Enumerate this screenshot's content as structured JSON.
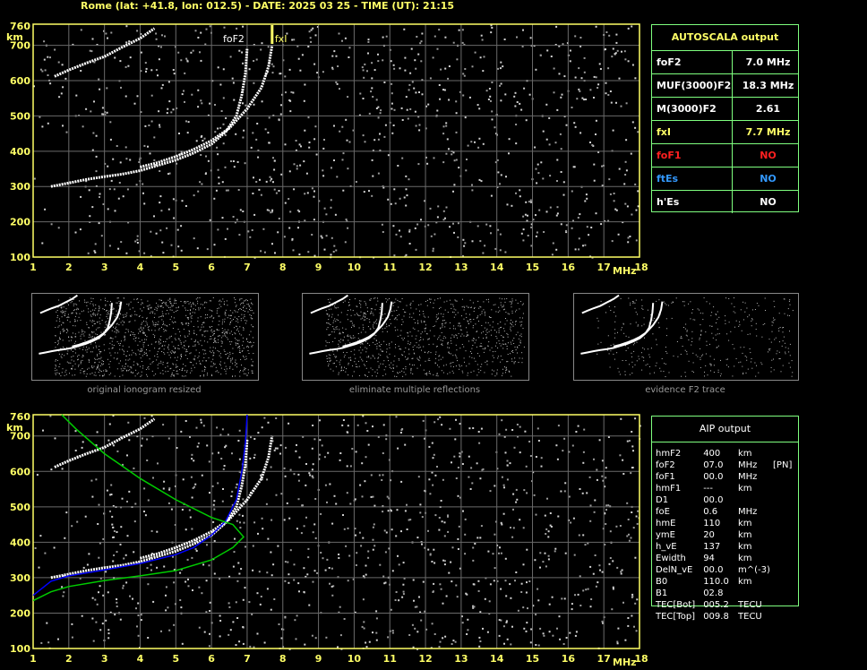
{
  "header": "Rome (lat: +41.8, lon: 012.5) - DATE: 2025 03 25 - TIME (UT): 21:15",
  "chart_data": [
    {
      "type": "scatter",
      "title": "",
      "xlabel": "MHz",
      "ylabel": "km",
      "xlim": [
        1,
        18
      ],
      "ylim": [
        100,
        760
      ],
      "xticks": [
        1,
        2,
        3,
        4,
        5,
        6,
        7,
        8,
        9,
        10,
        11,
        12,
        13,
        14,
        15,
        16,
        17,
        18
      ],
      "yticks": [
        100,
        200,
        300,
        400,
        500,
        600,
        700
      ],
      "ytop_label": "760",
      "grid": true,
      "annotations": [
        {
          "text": "foF2",
          "x": 7.0
        },
        {
          "text": "fxI",
          "x": 7.7
        }
      ],
      "series": [
        {
          "name": "",
          "color": "#ffffff",
          "points": [
            [
              1.5,
              300
            ],
            [
              2,
              310
            ],
            [
              2.5,
              320
            ],
            [
              3,
              328
            ],
            [
              3.5,
              335
            ],
            [
              4,
              345
            ],
            [
              4.5,
              360
            ],
            [
              5,
              375
            ],
            [
              5.5,
              395
            ],
            [
              6,
              420
            ],
            [
              6.4,
              455
            ],
            [
              6.7,
              500
            ],
            [
              6.85,
              560
            ],
            [
              6.95,
              620
            ],
            [
              7.0,
              690
            ]
          ]
        },
        {
          "name": "",
          "color": "#ffffff",
          "points": [
            [
              4,
              355
            ],
            [
              4.5,
              368
            ],
            [
              5,
              385
            ],
            [
              5.5,
              405
            ],
            [
              6,
              430
            ],
            [
              6.5,
              465
            ],
            [
              7,
              520
            ],
            [
              7.4,
              580
            ],
            [
              7.6,
              640
            ],
            [
              7.7,
              700
            ]
          ]
        },
        {
          "name": "",
          "color": "#ffffff",
          "points": [
            [
              1.6,
              612
            ],
            [
              2,
              630
            ],
            [
              2.5,
              650
            ],
            [
              3,
              668
            ],
            [
              3.5,
              695
            ],
            [
              4,
              720
            ],
            [
              4.4,
              748
            ]
          ]
        }
      ]
    },
    {
      "type": "line",
      "title": "",
      "xlabel": "MHz",
      "ylabel": "km",
      "xlim": [
        1,
        18
      ],
      "ylim": [
        100,
        760
      ],
      "xticks": [
        1,
        2,
        3,
        4,
        5,
        6,
        7,
        8,
        9,
        10,
        11,
        12,
        13,
        14,
        15,
        16,
        17,
        18
      ],
      "yticks": [
        100,
        200,
        300,
        400,
        500,
        600,
        700
      ],
      "ytop_label": "760",
      "grid": true,
      "series": [
        {
          "name": "",
          "color": "#ffffff",
          "points": [
            [
              1.5,
              300
            ],
            [
              2,
              310
            ],
            [
              2.5,
              320
            ],
            [
              3,
              328
            ],
            [
              3.5,
              335
            ],
            [
              4,
              345
            ],
            [
              4.5,
              360
            ],
            [
              5,
              375
            ],
            [
              5.5,
              395
            ],
            [
              6,
              420
            ],
            [
              6.4,
              455
            ],
            [
              6.7,
              500
            ],
            [
              6.85,
              560
            ],
            [
              6.95,
              620
            ],
            [
              7.0,
              690
            ]
          ]
        },
        {
          "name": "",
          "color": "#ffffff",
          "points": [
            [
              4,
              355
            ],
            [
              4.5,
              368
            ],
            [
              5,
              385
            ],
            [
              5.5,
              405
            ],
            [
              6,
              430
            ],
            [
              6.5,
              465
            ],
            [
              7,
              520
            ],
            [
              7.4,
              580
            ],
            [
              7.6,
              640
            ],
            [
              7.7,
              700
            ]
          ]
        },
        {
          "name": "",
          "color": "#ffffff",
          "points": [
            [
              1.6,
              612
            ],
            [
              2,
              630
            ],
            [
              2.5,
              650
            ],
            [
              3,
              668
            ],
            [
              3.5,
              695
            ],
            [
              4,
              720
            ],
            [
              4.4,
              748
            ]
          ]
        },
        {
          "name": "",
          "color": "#0000ff",
          "points": [
            [
              1,
              250
            ],
            [
              1.5,
              290
            ],
            [
              2,
              305
            ],
            [
              3,
              322
            ],
            [
              4,
              340
            ],
            [
              5,
              365
            ],
            [
              5.5,
              385
            ],
            [
              6,
              420
            ],
            [
              6.4,
              460
            ],
            [
              6.7,
              520
            ],
            [
              6.85,
              600
            ],
            [
              6.95,
              680
            ],
            [
              7.0,
              760
            ]
          ]
        },
        {
          "name": "",
          "color": "#00cc00",
          "points": [
            [
              1,
              235
            ],
            [
              1.5,
              260
            ],
            [
              2,
              275
            ],
            [
              3,
              292
            ],
            [
              4,
              305
            ],
            [
              5,
              320
            ],
            [
              6,
              350
            ],
            [
              6.6,
              385
            ],
            [
              6.9,
              415
            ],
            [
              6.6,
              450
            ],
            [
              6.0,
              470
            ],
            [
              5,
              520
            ],
            [
              4,
              580
            ],
            [
              3,
              650
            ],
            [
              2.2,
              720
            ],
            [
              1.8,
              760
            ]
          ]
        }
      ]
    }
  ],
  "autoscala": {
    "title": "AUTOSCALA output",
    "rows": [
      {
        "k": "foF2",
        "v": "7.0 MHz",
        "color": "#ffffff"
      },
      {
        "k": "MUF(3000)F2",
        "v": "18.3 MHz",
        "color": "#ffffff"
      },
      {
        "k": "M(3000)F2",
        "v": "2.61",
        "color": "#ffffff"
      },
      {
        "k": "fxI",
        "v": "7.7 MHz",
        "color": "#ffff66"
      },
      {
        "k": "foF1",
        "v": "NO",
        "color": "#ff2020"
      },
      {
        "k": "ftEs",
        "v": "NO",
        "color": "#3399ff"
      },
      {
        "k": "h'Es",
        "v": "NO",
        "color": "#ffffff"
      }
    ]
  },
  "aip": {
    "title": "AIP output",
    "rows": [
      {
        "k": "hmF2",
        "v": "400",
        "u": "km",
        "e": ""
      },
      {
        "k": "foF2",
        "v": "07.0",
        "u": "MHz",
        "e": "[PN]"
      },
      {
        "k": "foF1",
        "v": "00.0",
        "u": "MHz",
        "e": ""
      },
      {
        "k": "hmF1",
        "v": "---",
        "u": "km",
        "e": ""
      },
      {
        "k": "D1",
        "v": "00.0",
        "u": "",
        "e": ""
      },
      {
        "k": "foE",
        "v": "0.6",
        "u": "MHz",
        "e": ""
      },
      {
        "k": "hmE",
        "v": "110",
        "u": "km",
        "e": ""
      },
      {
        "k": "ymE",
        "v": "20",
        "u": "km",
        "e": ""
      },
      {
        "k": "h_vE",
        "v": "137",
        "u": "km",
        "e": ""
      },
      {
        "k": "Ewidth",
        "v": "94",
        "u": "km",
        "e": ""
      },
      {
        "k": "DelN_vE",
        "v": "00.0",
        "u": "m^(-3)",
        "e": ""
      },
      {
        "k": "B0",
        "v": "110.0",
        "u": "km",
        "e": ""
      },
      {
        "k": "B1",
        "v": "02.8",
        "u": "",
        "e": ""
      },
      {
        "k": "TEC[Bot]",
        "v": "005.2",
        "u": "TECU",
        "e": ""
      },
      {
        "k": "TEC[Top]",
        "v": "009.8",
        "u": "TECU",
        "e": ""
      }
    ]
  },
  "thumbs": [
    {
      "caption": "original ionogram resized"
    },
    {
      "caption": "eliminate multiple reflections"
    },
    {
      "caption": "evidence F2 trace"
    }
  ]
}
